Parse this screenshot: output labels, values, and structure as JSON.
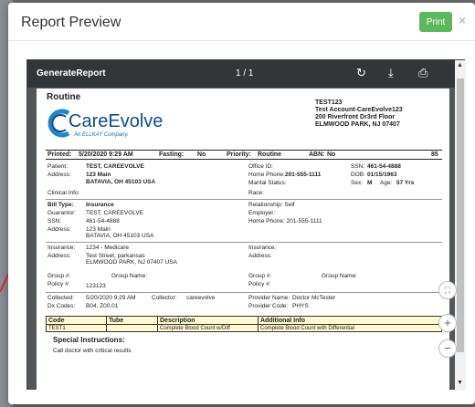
{
  "modal": {
    "title": "Report Preview",
    "print_label": "Print",
    "close_label": "×"
  },
  "viewer": {
    "title": "GenerateReport",
    "page_indicator": "1 / 1"
  },
  "report": {
    "routine": "Routine",
    "logo_name": "CareEvolve",
    "logo_tagline": "An ELLKAY Company.",
    "account": [
      "TEST123",
      "Test Account-CareEvolve123",
      "200 Riverfront Dr3rd Floor",
      "ELMWOOD PARK, NJ  07407"
    ],
    "printed_label": "Printed:",
    "printed_value": "5/20/2020 9:29 AM",
    "fasting_label": "Fasting:",
    "fasting_value": "No",
    "priority_label": "Priority:",
    "priority_value": "Routine",
    "abn_label": "ABN:",
    "abn_value": "No",
    "page_num": "85",
    "patient_label": "Patient:",
    "patient_value": "TEST, CAREEVOLVE",
    "address_label": "Address:",
    "address_line1": "123 Main",
    "address_line2": "BATAVIA, OH 45103 USA",
    "clinical_label": "Clinical Info:",
    "office_label": "Office ID:",
    "home_phone_label": "Home Phone:",
    "home_phone_value": "201-555-1111",
    "marital_label": "Marital Status:",
    "race_label": "Race:",
    "ssn_label": "SSN:",
    "ssn_value": "461-54-4888",
    "dob_label": "DOB:",
    "dob_value": "01/15/1963",
    "sex_label": "Sex:",
    "sex_value": "M",
    "age_label": "Age:",
    "age_value": "57 Yrs",
    "bill_type_label": "Bill Type:",
    "bill_type_value": "Insurance",
    "guarantor_label": "Guarantor:",
    "guarantor_value": "TEST, CAREEVOLVE",
    "g_ssn_label": "SSN:",
    "g_ssn_value": "461-54-4888",
    "g_address_label": "Address:",
    "g_address_line1": "123 Main",
    "g_address_line2": "BATAVIA, OH 45103 USA",
    "relationship": "Relationship: Self",
    "employer": "Employer:",
    "g_home_phone": "Home Phone: 201-555-1111",
    "insurance_label": "Insurance:",
    "insurance_value": "1234 - Medicare",
    "ins_address_label": "Address:",
    "ins_address_line1": "Test Street, parkansas",
    "ins_address_line2": "ELMWOOD PARK, NJ 07407  USA",
    "insurance2_label": "Insurance:",
    "address2_label": "Address:",
    "group_label": "Group #:",
    "group_name_label": "Group Name:",
    "policy_label": "Policy #:",
    "policy_value": "123123",
    "group2_label": "Group #:",
    "group_name2_label": "Group Name:",
    "policy2_label": "Policy #:",
    "collected_label": "Collected:",
    "collected_value": "5/20/2020    9:29 AM",
    "collector_label": "Collector:",
    "collector_value": "careevolve",
    "dx_label": "Dx Codes:",
    "dx_value": "B04, Z00.01",
    "provider_label": "Provider Name:",
    "provider_value": "Doctor McTester",
    "provider_code_label": "Provider Code:",
    "provider_code_value": "PHYS",
    "table_headers": [
      "Code",
      "Tube",
      "Description",
      "Additional Info"
    ],
    "table_row": [
      "TEST1",
      "",
      "Complete Blood Count w/Diff",
      "Complete Blood Count with Differential"
    ],
    "special_label": "Special Instructions:",
    "special_text": "Call doctor with critical results"
  },
  "colors": {
    "print_button": "#5cb85c",
    "logo": "#0a4f8c",
    "table_highlight": "#fffacd"
  }
}
